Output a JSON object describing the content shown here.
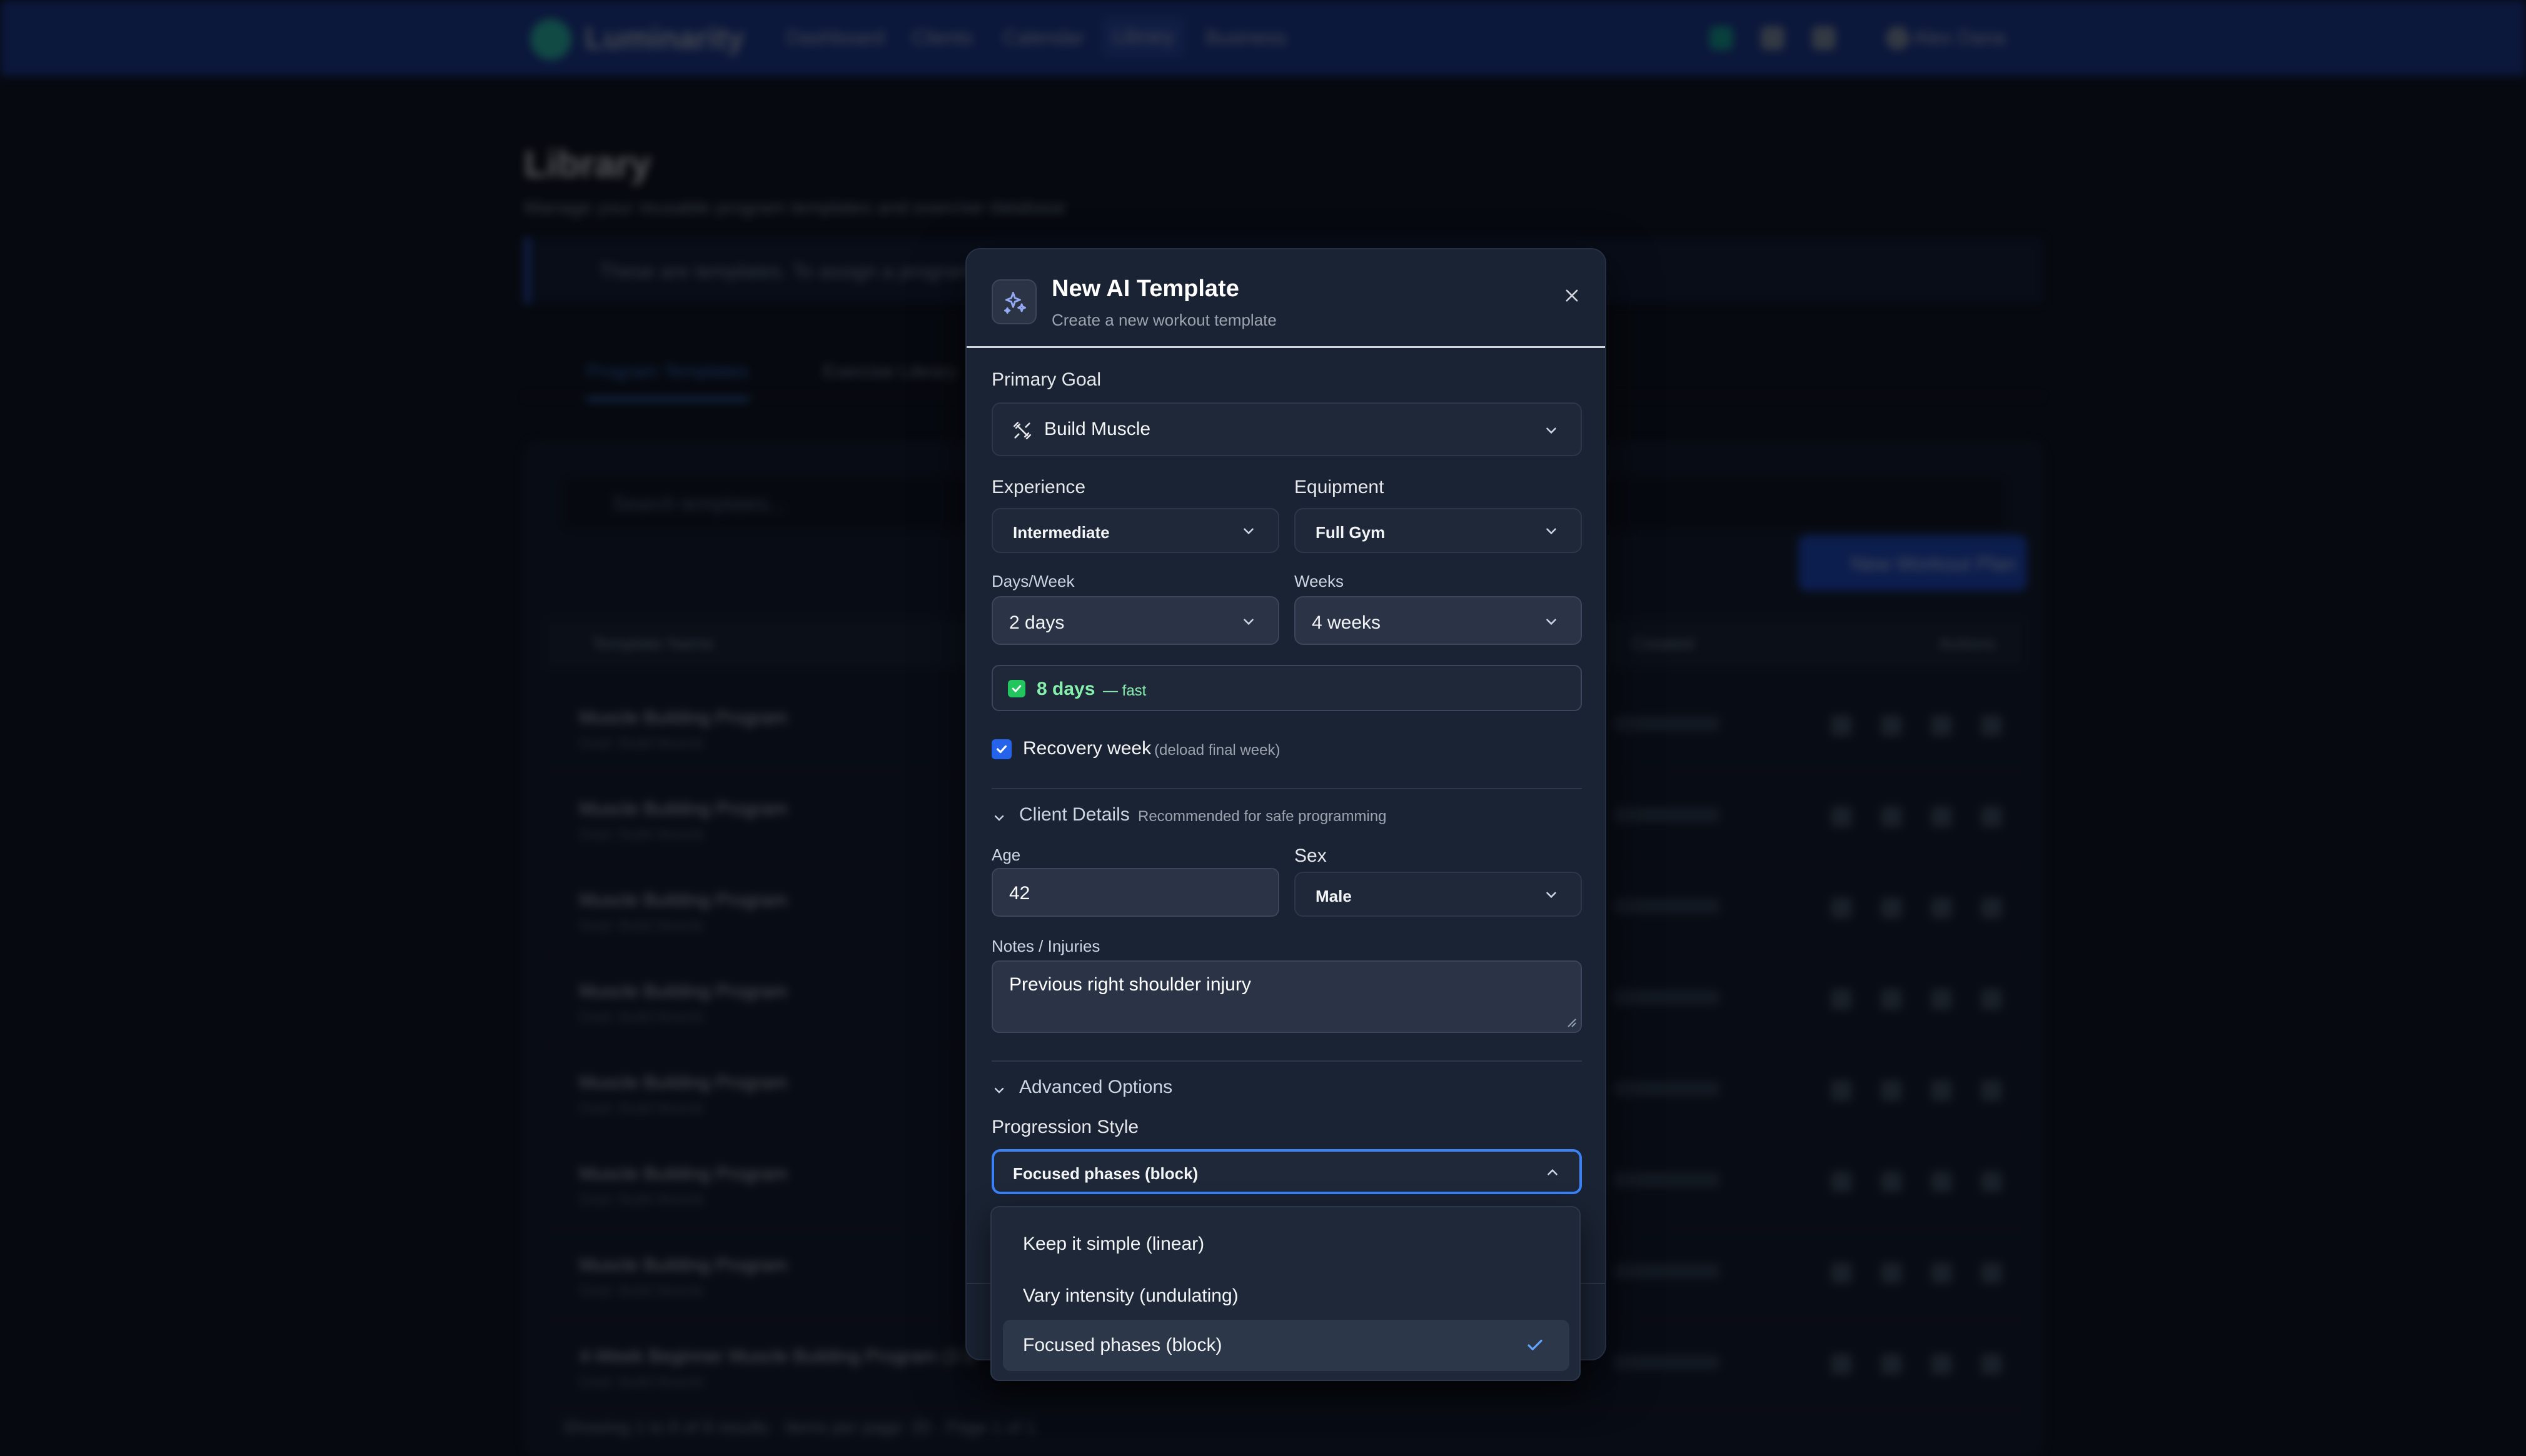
{
  "background": {
    "nav": {
      "brand": "Luminarity",
      "items": [
        "Dashboard",
        "Clients",
        "Calendar",
        "Library",
        "Business"
      ],
      "active": "Library",
      "user": "Alex Dana"
    },
    "page": {
      "title": "Library",
      "subtitle": "Manage your reusable program templates and exercise database",
      "banner": "These are templates. To assign a program to a client..."
    },
    "tabs": [
      "Program Templates",
      "Exercise Library"
    ],
    "search_placeholder": "Search templates...",
    "new_plan_label": "New Workout Plan",
    "table": {
      "headers": [
        "Template Name",
        "Created",
        "Actions"
      ],
      "rows": [
        {
          "name": "Muscle Building Program",
          "sub": "Goal: Build Muscle"
        },
        {
          "name": "Muscle Building Program",
          "sub": "Goal: Build Muscle"
        },
        {
          "name": "Muscle Building Program",
          "sub": "Goal: Build Muscle"
        },
        {
          "name": "Muscle Building Program",
          "sub": "Goal: Build Muscle"
        },
        {
          "name": "Muscle Building Program",
          "sub": "Goal: Build Muscle"
        },
        {
          "name": "Muscle Building Program",
          "sub": "Goal: Build Muscle"
        },
        {
          "name": "Muscle Building Program",
          "sub": "Goal: Build Muscle"
        },
        {
          "name": "4-Week Beginner Muscle Building Program (3 D",
          "sub": "Goal: Build Muscle"
        }
      ],
      "footer": "Showing 1 to 8 of 8 results · Items per page: 20 · Page 1 of 1"
    }
  },
  "modal": {
    "title": "New AI Template",
    "subtitle": "Create a new workout template",
    "primary_goal_label": "Primary Goal",
    "primary_goal_value": "Build Muscle",
    "experience_label": "Experience",
    "experience_value": "Intermediate",
    "equipment_label": "Equipment",
    "equipment_value": "Full Gym",
    "days_label": "Days/Week",
    "days_value": "2 days",
    "weeks_label": "Weeks",
    "weeks_value": "4 weeks",
    "summary_days": "8 days",
    "summary_speed": "— fast",
    "recovery_label": "Recovery week",
    "recovery_hint": "(deload final week)",
    "recovery_checked": true,
    "client_details_title": "Client Details",
    "client_details_hint": "Recommended for safe programming",
    "age_label": "Age",
    "age_value": "42",
    "sex_label": "Sex",
    "sex_value": "Male",
    "notes_label": "Notes / Injuries",
    "notes_value": "Previous right shoulder injury",
    "advanced_title": "Advanced Options",
    "progression_label": "Progression Style",
    "progression_value": "Focused phases (block)",
    "progression_options": [
      {
        "label": "Keep it simple (linear)",
        "selected": false
      },
      {
        "label": "Vary intensity (undulating)",
        "selected": false
      },
      {
        "label": "Focused phases (block)",
        "selected": true
      }
    ]
  },
  "colors": {
    "accent": "#3b82f6",
    "nav_bg": "#1a3a9e",
    "modal_bg": "#1a2333",
    "success": "#86efac"
  }
}
